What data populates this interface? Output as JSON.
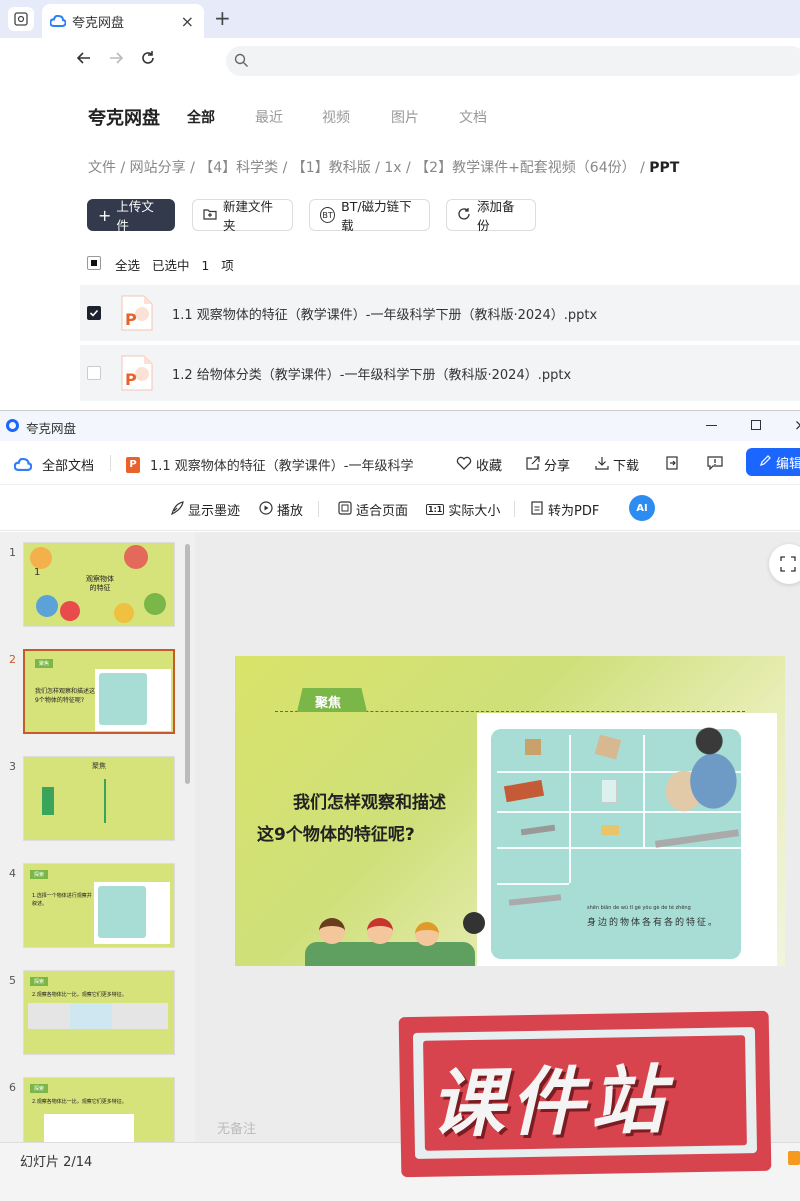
{
  "browser": {
    "tab_title": "夸克网盘",
    "new_tab": "+",
    "close": "×"
  },
  "app": {
    "brand": "夸克网盘",
    "tabs": [
      "全部",
      "最近",
      "视频",
      "图片",
      "文档"
    ]
  },
  "breadcrumb": [
    "文件",
    "网站分享",
    "【4】科学类",
    "【1】教科版",
    "1x",
    "【2】教学课件+配套视频（64份）"
  ],
  "breadcrumb_current": "PPT",
  "toolbar": {
    "upload": "上传文件",
    "new_folder": "新建文件夹",
    "bt": "BT/磁力链下载",
    "backup": "添加备份"
  },
  "selection": {
    "select_all": "全选",
    "selected_prefix": "已选中",
    "count": "1",
    "unit": "项"
  },
  "files": [
    {
      "name": "1.1 观察物体的特征（教学课件）-一年级科学下册（教科版·2024）.pptx",
      "checked": true
    },
    {
      "name": "1.2 给物体分类（教学课件）-一年级科学下册（教科版·2024）.pptx",
      "checked": false
    }
  ],
  "viewer": {
    "window_title": "夸克网盘",
    "all_docs": "全部文档",
    "doc_title": "1.1 观察物体的特征（教学课件）-一年级科学",
    "favorite": "收藏",
    "share": "分享",
    "download": "下载",
    "edit": "编辑",
    "show_ink": "显示墨迹",
    "play": "播放",
    "fit_page": "适合页面",
    "actual_size": "实际大小",
    "to_pdf": "转为PDF",
    "ai": "AI",
    "no_notes": "无备注",
    "slide_indicator": "幻灯片 2/14"
  },
  "thumbnails": [
    {
      "num": "1",
      "text": "观察物体的特征",
      "mark": "1"
    },
    {
      "num": "2",
      "text": "我们怎样观察和描述这9个物体的特征呢?",
      "tag": "聚焦"
    },
    {
      "num": "3",
      "text": "聚焦"
    },
    {
      "num": "4",
      "text": "1.选择一个物体进行观察并叙述。",
      "tag": "探索"
    },
    {
      "num": "5",
      "text": "2.观察各物体比一比，观察它们更多特征。",
      "tag": "探索"
    },
    {
      "num": "6",
      "text": "2.观察各物体比一比，观察它们更多特征。",
      "tag": "探索"
    }
  ],
  "slide": {
    "tag": "聚焦",
    "question_line1": "我们怎样观察和描述",
    "question_line2": "这9个物体的特征呢?",
    "pinyin": "shēn biān de wù tǐ gè yǒu gè de tè zhēng",
    "caption": "身边的物体各有各的特征。"
  },
  "watermark": "课件站",
  "colors": {
    "accent_blue": "#1a66ff",
    "slide_green": "#d6e36a",
    "tag_green": "#7ab648",
    "thumb_selected": "#c65a2a",
    "watermark_red": "#d8444e"
  }
}
